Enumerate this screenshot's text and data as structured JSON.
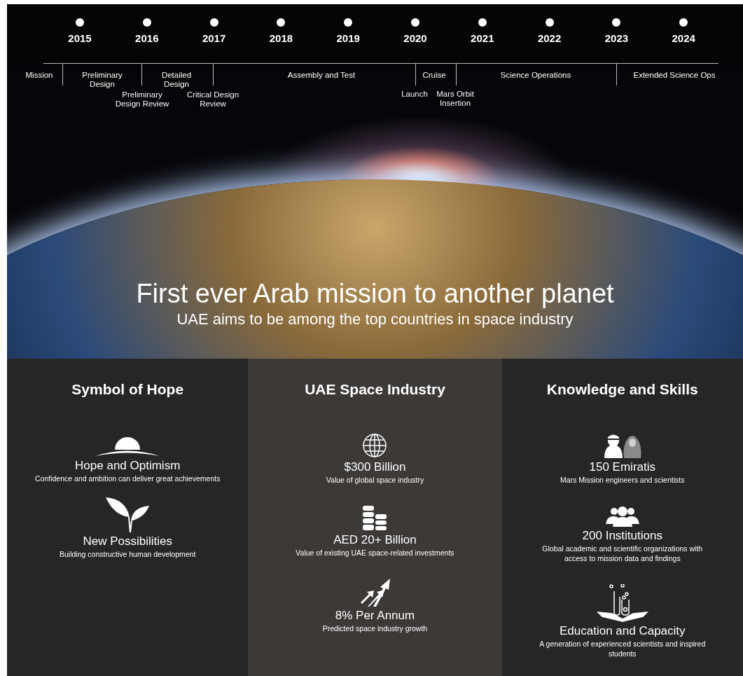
{
  "timeline": {
    "years": [
      "2015",
      "2016",
      "2017",
      "2018",
      "2019",
      "2020",
      "2021",
      "2022",
      "2023",
      "2024"
    ],
    "phases": [
      {
        "label": "Mission"
      },
      {
        "label": "Preliminary Design"
      },
      {
        "label": "Detailed Design"
      },
      {
        "label": "Assembly and Test"
      },
      {
        "label": "Cruise"
      },
      {
        "label": "Science Operations"
      },
      {
        "label": "Extended Science Ops"
      }
    ],
    "milestones": [
      {
        "label": "Preliminary Design Review"
      },
      {
        "label": "Critical Design Review"
      },
      {
        "label": "Launch"
      },
      {
        "label": "Mars Orbit Insertion"
      }
    ]
  },
  "hero": {
    "title": "First ever Arab mission to another planet",
    "subtitle": "UAE aims to be among the top countries in space industry"
  },
  "columns": [
    {
      "heading": "Symbol of Hope",
      "items": [
        {
          "kind": "sunrise",
          "title": "Hope and Optimism",
          "description": "Confidence and ambition can deliver great achievements"
        },
        {
          "kind": "sprout",
          "title": "New Possibilities",
          "description": "Building constructive human development"
        }
      ]
    },
    {
      "heading": "UAE Space Industry",
      "items": [
        {
          "kind": "globe",
          "title": "$300 Billion",
          "description": "Value of global space industry"
        },
        {
          "kind": "coins",
          "title": "AED 20+ Billion",
          "description": "Value of existing UAE space-related investments"
        },
        {
          "kind": "growth",
          "title": "8% Per Annum",
          "description": "Predicted space industry growth"
        }
      ]
    },
    {
      "heading": "Knowledge and Skills",
      "items": [
        {
          "kind": "people",
          "title": "150 Emiratis",
          "description": "Mars Mission engineers and scientists"
        },
        {
          "kind": "group",
          "title": "200 Institutions",
          "description": "Global academic and scientific organizations with access to mission data and findings"
        },
        {
          "kind": "education",
          "title": "Education and Capacity",
          "description": "A generation of experienced scientists and inspired students"
        }
      ]
    }
  ]
}
